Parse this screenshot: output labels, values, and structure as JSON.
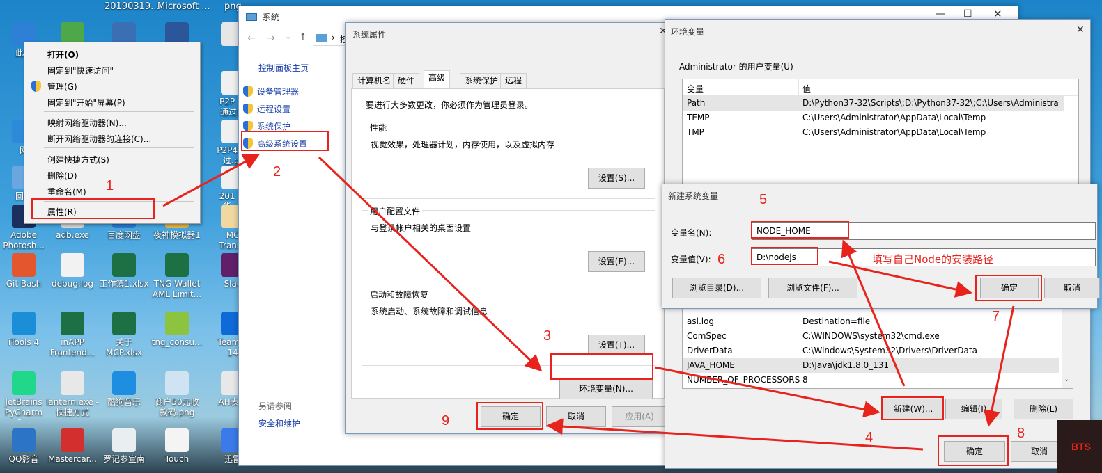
{
  "desktop": {
    "top_labels": [
      "20190319...",
      "Microsoft ...",
      "png"
    ],
    "icons": [
      {
        "label": "此电",
        "color": "#2e7fd6"
      },
      {
        "label": "",
        "color": "#4ea84a"
      },
      {
        "label": "",
        "color": "#3b6fb3"
      },
      {
        "label": "",
        "color": "#2b579a"
      },
      {
        "label": "",
        "color": "#e6e6e6"
      },
      {
        "label": "P2P 目\n通过的",
        "color": "#f0f0f0"
      },
      {
        "label": "网",
        "color": "#2c8ad8"
      },
      {
        "label": "P2P4 个\n过.pt",
        "color": "#f0f0f0"
      },
      {
        "label": "回收",
        "color": "#6aa6e0"
      },
      {
        "label": "201 个\n货.pt",
        "color": "#f0f0f0"
      },
      {
        "label": "Adobe\nPhotosh...",
        "color": "#1b2f5e"
      },
      {
        "label": "adb.exe",
        "color": "#d8d8d8"
      },
      {
        "label": "百度网盘",
        "color": "#2a7ad2"
      },
      {
        "label": "夜神模拟器1",
        "color": "#e4b64a"
      },
      {
        "label": "MC\nTransa",
        "color": "#f0d9a0"
      },
      {
        "label": "Git Bash",
        "color": "#e4572e"
      },
      {
        "label": "debug.log",
        "color": "#f2f2f2"
      },
      {
        "label": "工作簿1.xlsx",
        "color": "#1d7044"
      },
      {
        "label": "TNG Wallet\nAML Limit...",
        "color": "#1d7044"
      },
      {
        "label": "Slac",
        "color": "#611f69"
      },
      {
        "label": "iTools 4",
        "color": "#1a8fd8"
      },
      {
        "label": "inAPP\nFrontend...",
        "color": "#1d7044"
      },
      {
        "label": "关于\nMCP.xlsx",
        "color": "#1d7044"
      },
      {
        "label": "tng_consu...",
        "color": "#8cc43f"
      },
      {
        "label": "TeamVi\n14",
        "color": "#0e6ad8"
      },
      {
        "label": "JetBrains\nPyCharm 2...",
        "color": "#21d789"
      },
      {
        "label": "lantern.exe -\n快捷方式",
        "color": "#e8e8e8"
      },
      {
        "label": "酷狗音乐",
        "color": "#1e8fe0"
      },
      {
        "label": "商户50元收\n款码.png",
        "color": "#cfe3f2"
      },
      {
        "label": "AH表头",
        "color": "#e8e8e8"
      },
      {
        "label": "QQ影音",
        "color": "#2b74c6"
      },
      {
        "label": "Mastercar...",
        "color": "#d32f2f"
      },
      {
        "label": "罗记参宣南",
        "color": "#e9eef0"
      },
      {
        "label": "Touch",
        "color": "#f4f4f4"
      },
      {
        "label": "迅雷",
        "color": "#3b7ae8"
      }
    ]
  },
  "context_menu": {
    "items": [
      "打开(O)",
      "固定到\"快速访问\"",
      "管理(G)",
      "固定到\"开始\"屏幕(P)",
      "映射网络驱动器(N)...",
      "断开网络驱动器的连接(C)...",
      "创建快捷方式(S)",
      "删除(D)",
      "重命名(M)",
      "属性(R)"
    ]
  },
  "system_window": {
    "title": "系统",
    "nav_partial": "控",
    "home": "控制面板主页",
    "links": [
      "设备管理器",
      "远程设置",
      "系统保护",
      "高级系统设置"
    ],
    "see_also": "另请参阅",
    "see_also_link": "安全和维护"
  },
  "sysprops": {
    "title": "系统属性",
    "tabs": [
      "计算机名",
      "硬件",
      "高级",
      "系统保护",
      "远程"
    ],
    "admin_note": "要进行大多数更改，你必须作为管理员登录。",
    "perf_title": "性能",
    "perf_desc": "视觉效果，处理器计划，内存使用，以及虚拟内存",
    "profile_title": "用户配置文件",
    "profile_desc": "与登录帐户相关的桌面设置",
    "startup_title": "启动和故障恢复",
    "startup_desc": "系统启动、系统故障和调试信息",
    "btn_settings_s": "设置(S)...",
    "btn_settings_e": "设置(E)...",
    "btn_settings_t": "设置(T)...",
    "btn_env": "环境变量(N)...",
    "btn_ok": "确定",
    "btn_cancel": "取消",
    "btn_apply": "应用(A)"
  },
  "envvars": {
    "title": "环境变量",
    "user_section": "Administrator 的用户变量(U)",
    "col_var": "变量",
    "col_val": "值",
    "user_rows": [
      {
        "name": "Path",
        "value": "D:\\Python37-32\\Scripts\\;D:\\Python37-32\\;C:\\Users\\Administra..."
      },
      {
        "name": "TEMP",
        "value": "C:\\Users\\Administrator\\AppData\\Local\\Temp"
      },
      {
        "name": "TMP",
        "value": "C:\\Users\\Administrator\\AppData\\Local\\Temp"
      }
    ],
    "sys_rows": [
      {
        "name": "asl.log",
        "value": "Destination=file"
      },
      {
        "name": "ComSpec",
        "value": "C:\\WINDOWS\\system32\\cmd.exe"
      },
      {
        "name": "DriverData",
        "value": "C:\\Windows\\System32\\Drivers\\DriverData"
      },
      {
        "name": "JAVA_HOME",
        "value": "D:\\Java\\jdk1.8.0_131"
      },
      {
        "name": "NUMBER_OF_PROCESSORS",
        "value": "8"
      }
    ],
    "btn_new": "新建(W)...",
    "btn_edit": "编辑(I)",
    "btn_delete": "删除(L)",
    "btn_ok": "确定",
    "btn_cancel": "取消"
  },
  "newvar": {
    "title": "新建系统变量",
    "name_label": "变量名(N):",
    "name_value": "NODE_HOME",
    "value_label": "变量值(V):",
    "value_value": "D:\\nodejs",
    "btn_browse_dir": "浏览目录(D)...",
    "btn_browse_file": "浏览文件(F)...",
    "btn_ok": "确定",
    "btn_cancel": "取消"
  },
  "annotations": {
    "steps": [
      "1",
      "2",
      "3",
      "4",
      "5",
      "6",
      "7",
      "8",
      "9"
    ],
    "note": "填写自己Node的安装路径",
    "color": "#e8231d"
  },
  "corner_logo": "BTS"
}
